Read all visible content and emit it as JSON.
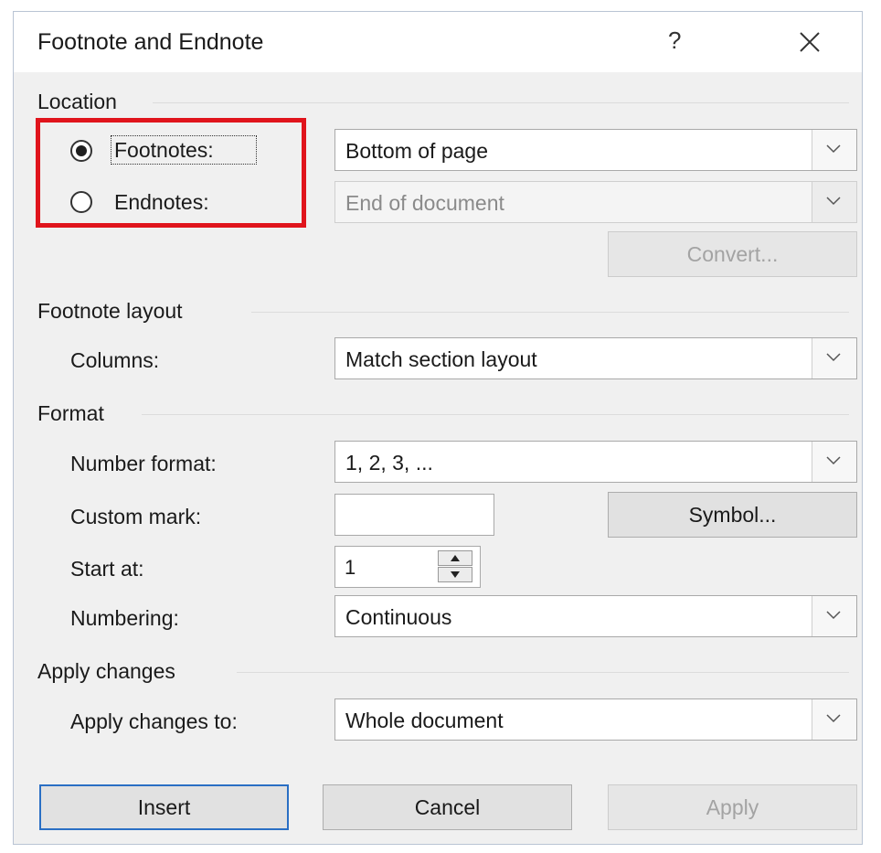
{
  "dialog": {
    "title": "Footnote and Endnote",
    "help_label": "?",
    "close_icon": "close-icon"
  },
  "location": {
    "heading": "Location",
    "footnotes_label": "Footnotes:",
    "endnotes_label": "Endnotes:",
    "selected": "footnotes",
    "footnotes_position": "Bottom of page",
    "endnotes_position": "End of document",
    "convert_label": "Convert..."
  },
  "footnote_layout": {
    "heading": "Footnote layout",
    "columns_label": "Columns:",
    "columns_value": "Match section layout"
  },
  "format": {
    "heading": "Format",
    "number_format_label": "Number format:",
    "number_format_value": "1, 2, 3, ...",
    "custom_mark_label": "Custom mark:",
    "custom_mark_value": "",
    "symbol_label": "Symbol...",
    "start_at_label": "Start at:",
    "start_at_value": "1",
    "numbering_label": "Numbering:",
    "numbering_value": "Continuous"
  },
  "apply_changes": {
    "heading": "Apply changes",
    "apply_to_label": "Apply changes to:",
    "apply_to_value": "Whole document"
  },
  "buttons": {
    "insert": "Insert",
    "cancel": "Cancel",
    "apply": "Apply"
  },
  "colors": {
    "highlight_box": "#e0141c",
    "default_button_border": "#2a6fc4",
    "dialog_bg": "#f0f0f0"
  }
}
